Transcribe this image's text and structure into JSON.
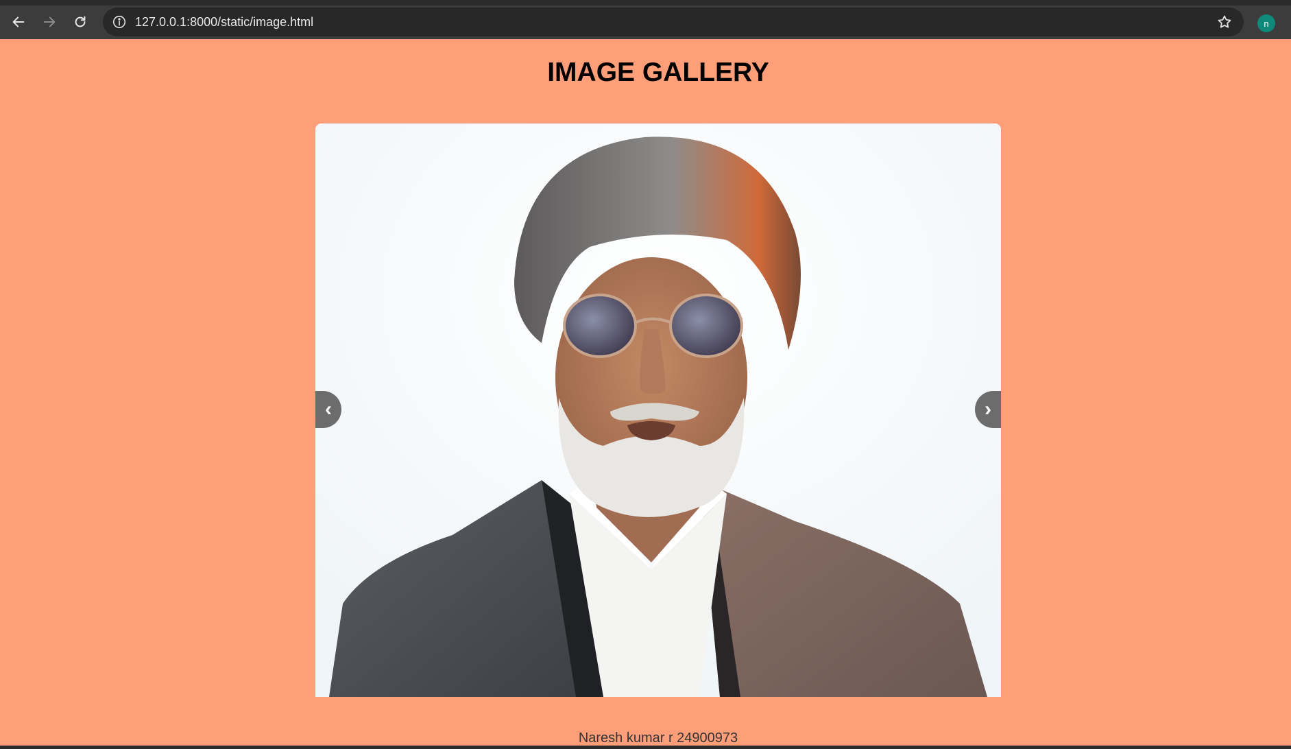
{
  "browser": {
    "url": "127.0.0.1:8000/static/image.html",
    "profile_initial": "n",
    "icons": {
      "back": "arrow-left-icon",
      "forward": "arrow-right-icon",
      "reload": "reload-icon",
      "info": "info-icon",
      "bookmark": "star-icon"
    }
  },
  "page": {
    "title": "IMAGE GALLERY",
    "prev_label": "‹",
    "next_label": "›",
    "footer": "Naresh kumar r 24900973",
    "background_color": "#ff9f7a"
  }
}
